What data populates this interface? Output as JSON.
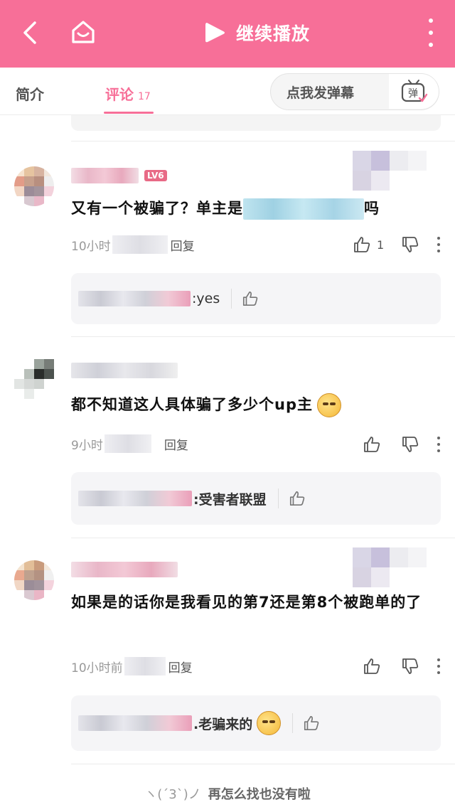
{
  "header": {
    "title": "继续播放",
    "accent": "#f76f98"
  },
  "tabs": {
    "intro": "简介",
    "comments": "评论",
    "comment_count": "17",
    "danmaku_placeholder": "点我发弹幕",
    "danmaku_icon_label": "弹"
  },
  "comments": [
    {
      "level": "LV6",
      "text_before": "又有一个被骗了？单主是",
      "text_after": "吗",
      "time": "10小时",
      "reply_label": "回复",
      "like_count": "1",
      "reply": {
        "text": ":yes"
      }
    },
    {
      "text": "都不知道这人具体骗了多少个up主",
      "time": "9小时",
      "reply_label": "回复",
      "reply": {
        "text": ":受害者联盟"
      }
    },
    {
      "text": "如果是的话你是我看见的第7还是第8个被跑单的了",
      "time": "10小时前",
      "reply_label": "回复",
      "reply": {
        "text": ".老骗来的"
      }
    }
  ],
  "footer": {
    "face": "ヽ(ˊ3ˋ)ノ",
    "text": "再怎么找也没有啦"
  }
}
